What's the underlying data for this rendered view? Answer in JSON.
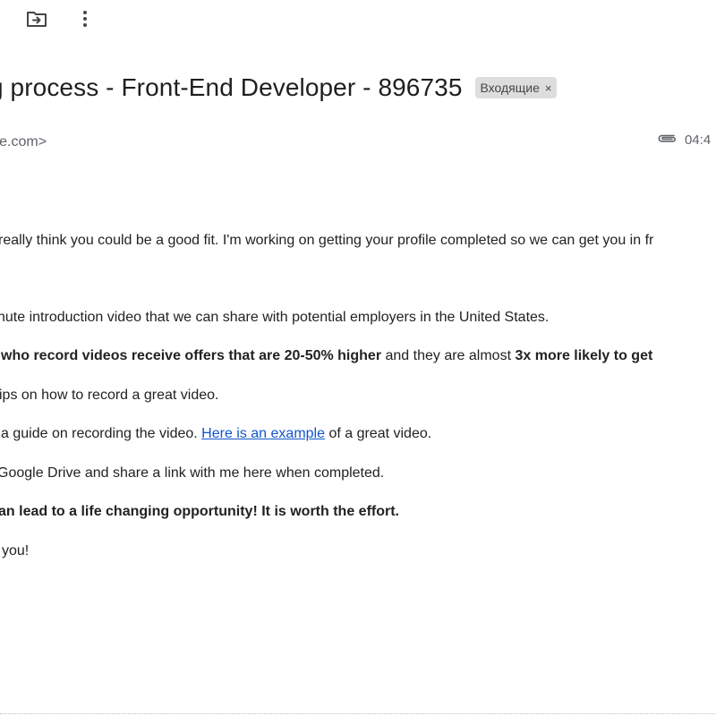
{
  "toolbar": {
    "move_icon": "move-to-folder-icon",
    "more_icon": "more-vertical-icon"
  },
  "email": {
    "subject": "g process - Front-End Developer - 896735",
    "label": "Входящие",
    "label_close": "×",
    "sender": "here.com>",
    "attachment_icon": "paperclip-icon",
    "time": "04:4"
  },
  "body": {
    "line1": "really think you could be a good fit. I'm working on getting your profile completed so we can get you in fr",
    "line2": "nute introduction video that we can share with potential employers in the United States.",
    "line3": {
      "bold1": "who record videos receive offers that are 20-50% higher",
      "text": " and they are almost ",
      "bold2": "3x more likely to get"
    },
    "line4": "ips on how to record a great video.",
    "line5": {
      "pre": "a guide on recording the video. ",
      "link": "Here is an example",
      "post": " of a great video."
    },
    "line6": "Google Drive and share a link with me here when completed.",
    "line7": "an lead to a life changing opportunity! It is worth the effort.",
    "line8": "you!"
  },
  "colors": {
    "link": "#1155cc",
    "chip_bg": "#dddddd",
    "muted": "#5f6368"
  }
}
